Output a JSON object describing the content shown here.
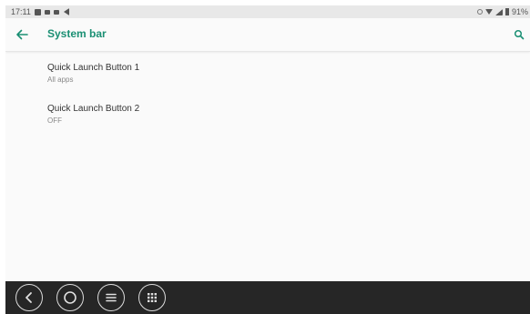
{
  "status_bar": {
    "time": "17:11",
    "battery": "91%"
  },
  "toolbar": {
    "title": "System bar"
  },
  "list": {
    "items": [
      {
        "title": "Quick Launch Button 1",
        "subtitle": "All apps"
      },
      {
        "title": "Quick Launch Button 2",
        "subtitle": "OFF"
      }
    ]
  },
  "icons": {
    "back": "arrow-left-icon",
    "search": "search-icon",
    "nav_back": "chevron-left-icon",
    "nav_home": "home-circle-icon",
    "nav_menu": "menu-icon",
    "nav_apps": "apps-grid-icon"
  },
  "colors": {
    "accent": "#1a8f73",
    "nav_bar": "#262626",
    "status_bar": "#e8e8e8"
  }
}
